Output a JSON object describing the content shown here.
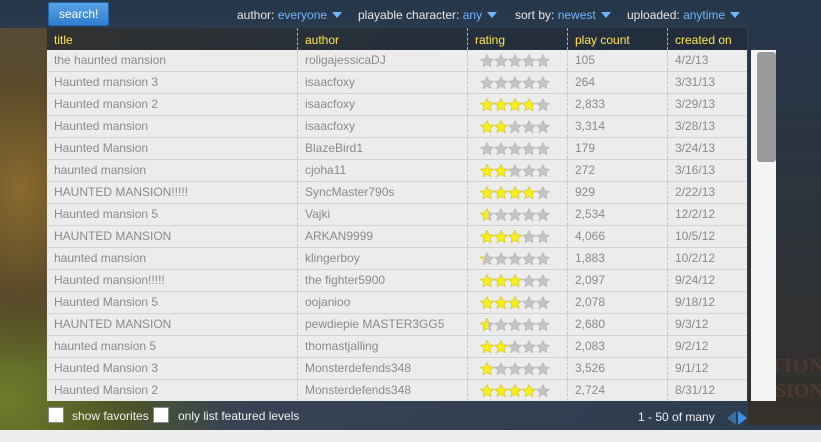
{
  "search_label": "search!",
  "filters": [
    {
      "label": "author:",
      "value": "everyone",
      "name": "author-filter"
    },
    {
      "label": "playable character:",
      "value": "any",
      "name": "character-filter"
    },
    {
      "label": "sort by:",
      "value": "newest",
      "name": "sort-filter"
    },
    {
      "label": "uploaded:",
      "value": "anytime",
      "name": "uploaded-filter"
    }
  ],
  "columns": [
    "title",
    "author",
    "rating",
    "play count",
    "created on"
  ],
  "rows": [
    {
      "title": "the haunted mansion",
      "author": "roligajessicaDJ",
      "rating": 0,
      "plays": "105",
      "created": "4/2/13"
    },
    {
      "title": "Haunted mansion 3",
      "author": "isaacfoxy",
      "rating": 0,
      "plays": "264",
      "created": "3/31/13"
    },
    {
      "title": "Haunted mansion 2",
      "author": "isaacfoxy",
      "rating": 3.8,
      "plays": "2,833",
      "created": "3/29/13"
    },
    {
      "title": "Haunted mansion",
      "author": "isaacfoxy",
      "rating": 2,
      "plays": "3,314",
      "created": "3/28/13"
    },
    {
      "title": "Haunted Mansion",
      "author": "BlazeBird1",
      "rating": 0,
      "plays": "179",
      "created": "3/24/13"
    },
    {
      "title": "haunted mansion",
      "author": "cjoha11",
      "rating": 2,
      "plays": "272",
      "created": "3/16/13"
    },
    {
      "title": "HAUNTED MANSION!!!!!",
      "author": "SyncMaster790s",
      "rating": 4,
      "plays": "929",
      "created": "2/22/13"
    },
    {
      "title": "Haunted mansion 5",
      "author": "Vajki",
      "rating": 0.6,
      "plays": "2,534",
      "created": "12/2/12"
    },
    {
      "title": "HAUNTED MANSION",
      "author": "ARKAN9999",
      "rating": 3,
      "plays": "4,066",
      "created": "10/5/12"
    },
    {
      "title": "haunted mansion",
      "author": "klingerboy",
      "rating": 0.3,
      "plays": "1,883",
      "created": "10/2/12"
    },
    {
      "title": "Haunted mansion!!!!!",
      "author": "the fighter5900",
      "rating": 3,
      "plays": "2,097",
      "created": "9/24/12"
    },
    {
      "title": "Haunted Mansion 5",
      "author": "oojanioo",
      "rating": 2.8,
      "plays": "2,078",
      "created": "9/18/12"
    },
    {
      "title": "HAUNTED MANSION",
      "author": "pewdiepie MASTER3GG5",
      "rating": 0.6,
      "plays": "2,680",
      "created": "9/3/12"
    },
    {
      "title": "haunted mansion 5",
      "author": "thomastjalling",
      "rating": 2,
      "plays": "2,083",
      "created": "9/2/12"
    },
    {
      "title": "Haunted Mansion 3",
      "author": "Monsterdefends348",
      "rating": 1,
      "plays": "3,526",
      "created": "9/1/12"
    },
    {
      "title": "Haunted Mansion 2",
      "author": "Monsterdefends348",
      "rating": 4,
      "plays": "2,724",
      "created": "8/31/12"
    }
  ],
  "options": {
    "favorites_label": "show favorites",
    "featured_label": "only list featured levels"
  },
  "pager": {
    "text": "1 - 50 of many"
  },
  "watermark": {
    "line1": "TION",
    "line2": "SION"
  },
  "colors": {
    "header_text": "#ffe94a",
    "link": "#6fb6ff",
    "star": "#f7f01e",
    "star_empty": "#c4c4c4"
  }
}
